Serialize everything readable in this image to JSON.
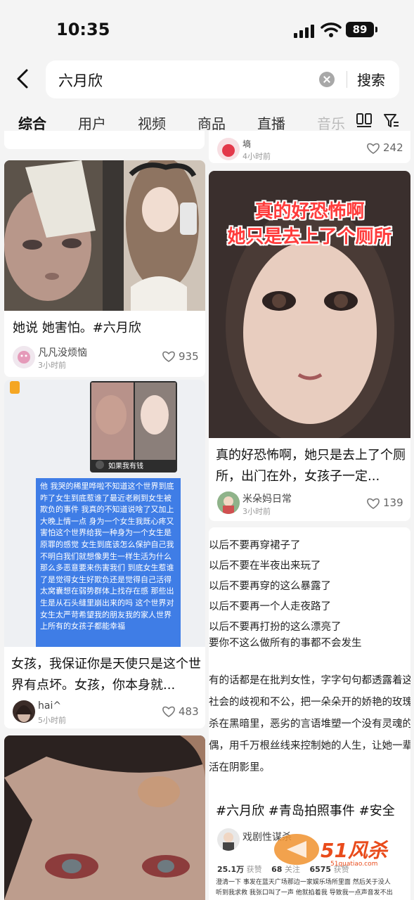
{
  "status_bar": {
    "time": "10:35",
    "battery": "89"
  },
  "search": {
    "query": "六月欣",
    "button": "搜索"
  },
  "tabs": [
    "综合",
    "用户",
    "视频",
    "商品",
    "直播",
    "音乐"
  ],
  "left_column": [
    {
      "caption": "她说 她害怕。#六月欣",
      "author": "凡凡没烦恼",
      "time": "3小时前",
      "likes": "935"
    },
    {
      "video_overlay": "如果我有钱",
      "chat_text": "他                我哭的稀里哗啦不知道这个世界到底咋了女生到底惹谁了最近老刷到女生被欺负的事件 我真的不知道说啥了又加上大晚上情一点 身为一个女生我既心疼又害怕这个世界给我一种身为一个女生是原罪的感觉 女生到底该怎么保护自己我不明白我们就想像男生一样生活为什么那么多恶意要来伤害我们 到底女生惹谁了是觉得女生好欺负还是觉得自己活得太窝囊想在弱势群体上找存在感 那些出生是从石头缝里崩出来的吗 这个世界对女生太严苛希望我的朋友我的家人世界上所有的女孩子都能幸福",
      "caption": "女孩，我保证你是天使只是这个世界有点坏。女孩，你本身就...",
      "author": "hai^",
      "time": "5小时前",
      "likes": "483"
    }
  ],
  "right_column": [
    {
      "author": "墒",
      "time": "4小时前",
      "likes": "242"
    },
    {
      "image_text": [
        "真的好恐怖啊",
        "她只是去上了个厕所"
      ],
      "caption": "真的好恐怖啊，她只是去上了个厕所，出门在外，女孩子一定...",
      "author": "米朵妈日常",
      "time": "3小时前",
      "likes": "139"
    },
    {
      "text_lines": [
        "以后不要再穿裙子了",
        "以后不要在半夜出来玩了",
        "以后不要再穿的这么暴露了",
        "以后不要再一个人走夜路了",
        "以后不要再打扮的这么漂亮了",
        "要你不这么做所有的事都不会发生",
        "有的话都是在批判女性，字字句句都透露着这",
        "社会的歧视和不公，把一朵朵开的娇艳的玫瑰",
        "杀在黑暗里，恶劣的言语堆塑一个没有灵魂的",
        "偶，用千万根丝线来控制她的人生，让她一辈",
        "活在阴影里。"
      ],
      "caption": "#六月欣 #青岛拍照事件 #安全",
      "author": "戏剧性谋杀",
      "stats": {
        "fans": "25.1万",
        "fans_label": "获赞",
        "following": "68",
        "following_label": "关注",
        "likes": "6575",
        "likes_label": "获赞"
      },
      "bottom_text": [
        "澄清一下 事发在蓝天广场那边一家娱乐场所里面 然后关于没人",
        "听到我求救 我张口叫了一声 他就掐着我 导致我一点声音发不出"
      ]
    }
  ],
  "watermark": {
    "text": "51风杀",
    "url": "51quatiao.com"
  },
  "colors": {
    "accent": "#111111",
    "chat_blue": "#3f7de6",
    "watermark": "#e94b1b"
  }
}
